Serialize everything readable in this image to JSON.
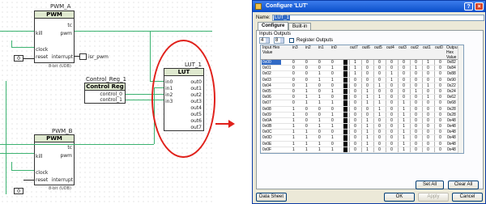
{
  "schematic": {
    "pwm_a": {
      "name": "PWM_A",
      "header": "PWM",
      "pins_left": [
        "kill",
        "clock",
        "reset"
      ],
      "pins_right": [
        "tc",
        "pwm",
        "interrupt"
      ],
      "note": "8-bit (UDB)",
      "output_label": "isr_pwm",
      "const_value": "0"
    },
    "control_reg": {
      "name": "Control_Reg_1",
      "header": "Control Reg",
      "pins": [
        "control_0",
        "control_1"
      ]
    },
    "lut": {
      "name": "LUT_1",
      "header": "LUT",
      "inputs": [
        "in0",
        "in1",
        "in2",
        "in3"
      ],
      "outputs": [
        "out0",
        "out1",
        "out2",
        "out3",
        "out4",
        "out5",
        "out6",
        "out7"
      ]
    },
    "pwm_b": {
      "name": "PWM_B",
      "header": "PWM",
      "pins_left": [
        "kill",
        "clock",
        "reset"
      ],
      "pins_right": [
        "tc",
        "pwm",
        "interrupt"
      ],
      "note": "8-bit (UDB)",
      "const_value": "0"
    },
    "highlight_color": "#e0211b",
    "wire_color": "#3cb371"
  },
  "dialog": {
    "title": "Configure 'LUT'",
    "name_label": "Name:",
    "name_value": "LUT_1",
    "tabs": [
      "Configure",
      "Built-in"
    ],
    "inputs_label": "Inputs",
    "inputs_value": "4",
    "outputs_label": "Outputs",
    "outputs_value": "8",
    "register_outputs_label": "Register Outputs",
    "register_outputs_checked": false,
    "table": {
      "headers": [
        "Input Hex Value",
        "in3",
        "in2",
        "in1",
        "in0",
        "out7",
        "out6",
        "out5",
        "out4",
        "out3",
        "out2",
        "out1",
        "out0",
        "Output Hex Value"
      ],
      "rows": [
        {
          "in_hex": "0x00",
          "ins": [
            "0",
            "0",
            "0",
            "0"
          ],
          "outs": [
            "1",
            "0",
            "0",
            "0",
            "0",
            "0",
            "1",
            "0"
          ],
          "out_hex": "0x82"
        },
        {
          "in_hex": "0x01",
          "ins": [
            "0",
            "0",
            "0",
            "1"
          ],
          "outs": [
            "1",
            "0",
            "0",
            "0",
            "0",
            "1",
            "0",
            "0"
          ],
          "out_hex": "0x84"
        },
        {
          "in_hex": "0x02",
          "ins": [
            "0",
            "0",
            "1",
            "0"
          ],
          "outs": [
            "1",
            "0",
            "0",
            "1",
            "0",
            "0",
            "0",
            "0"
          ],
          "out_hex": "0x88"
        },
        {
          "in_hex": "0x03",
          "ins": [
            "0",
            "0",
            "1",
            "1"
          ],
          "outs": [
            "0",
            "0",
            "0",
            "1",
            "0",
            "0",
            "0",
            "0"
          ],
          "out_hex": "0x90"
        },
        {
          "in_hex": "0x04",
          "ins": [
            "0",
            "1",
            "0",
            "0"
          ],
          "outs": [
            "0",
            "0",
            "1",
            "0",
            "0",
            "0",
            "1",
            "0"
          ],
          "out_hex": "0x22"
        },
        {
          "in_hex": "0x05",
          "ins": [
            "0",
            "1",
            "0",
            "1"
          ],
          "outs": [
            "0",
            "1",
            "0",
            "0",
            "0",
            "1",
            "0",
            "0"
          ],
          "out_hex": "0x24"
        },
        {
          "in_hex": "0x06",
          "ins": [
            "0",
            "1",
            "1",
            "0"
          ],
          "outs": [
            "0",
            "1",
            "1",
            "0",
            "0",
            "0",
            "1",
            "0"
          ],
          "out_hex": "0x62"
        },
        {
          "in_hex": "0x07",
          "ins": [
            "0",
            "1",
            "1",
            "1"
          ],
          "outs": [
            "0",
            "1",
            "1",
            "0",
            "1",
            "0",
            "0",
            "0"
          ],
          "out_hex": "0x68"
        },
        {
          "in_hex": "0x08",
          "ins": [
            "1",
            "0",
            "0",
            "0"
          ],
          "outs": [
            "0",
            "0",
            "1",
            "0",
            "1",
            "0",
            "0",
            "0"
          ],
          "out_hex": "0x28"
        },
        {
          "in_hex": "0x09",
          "ins": [
            "1",
            "0",
            "0",
            "1"
          ],
          "outs": [
            "0",
            "0",
            "1",
            "0",
            "1",
            "0",
            "0",
            "0"
          ],
          "out_hex": "0x28"
        },
        {
          "in_hex": "0x0A",
          "ins": [
            "1",
            "0",
            "1",
            "0"
          ],
          "outs": [
            "0",
            "1",
            "0",
            "0",
            "1",
            "0",
            "0",
            "0"
          ],
          "out_hex": "0x48"
        },
        {
          "in_hex": "0x0B",
          "ins": [
            "1",
            "0",
            "1",
            "1"
          ],
          "outs": [
            "0",
            "1",
            "0",
            "0",
            "1",
            "0",
            "0",
            "0"
          ],
          "out_hex": "0x48"
        },
        {
          "in_hex": "0x0C",
          "ins": [
            "1",
            "1",
            "0",
            "0"
          ],
          "outs": [
            "0",
            "1",
            "0",
            "0",
            "1",
            "0",
            "0",
            "0"
          ],
          "out_hex": "0x48"
        },
        {
          "in_hex": "0x0D",
          "ins": [
            "1",
            "1",
            "0",
            "1"
          ],
          "outs": [
            "0",
            "1",
            "0",
            "0",
            "1",
            "0",
            "0",
            "0"
          ],
          "out_hex": "0x48"
        },
        {
          "in_hex": "0x0E",
          "ins": [
            "1",
            "1",
            "1",
            "0"
          ],
          "outs": [
            "0",
            "1",
            "0",
            "0",
            "1",
            "0",
            "0",
            "0"
          ],
          "out_hex": "0x48"
        },
        {
          "in_hex": "0x0F",
          "ins": [
            "1",
            "1",
            "1",
            "1"
          ],
          "outs": [
            "0",
            "1",
            "0",
            "0",
            "1",
            "0",
            "0",
            "0"
          ],
          "out_hex": "0x48"
        }
      ],
      "selected_row": "0x00"
    },
    "buttons": {
      "set_all": "Set All",
      "clear_all": "Clear All",
      "datasheet": "Data Sheet",
      "ok": "OK",
      "apply": "Apply",
      "cancel": "Cancel"
    },
    "help_glyph": "?",
    "close_glyph": "×",
    "titlebar_color": "#0a4ec9"
  }
}
